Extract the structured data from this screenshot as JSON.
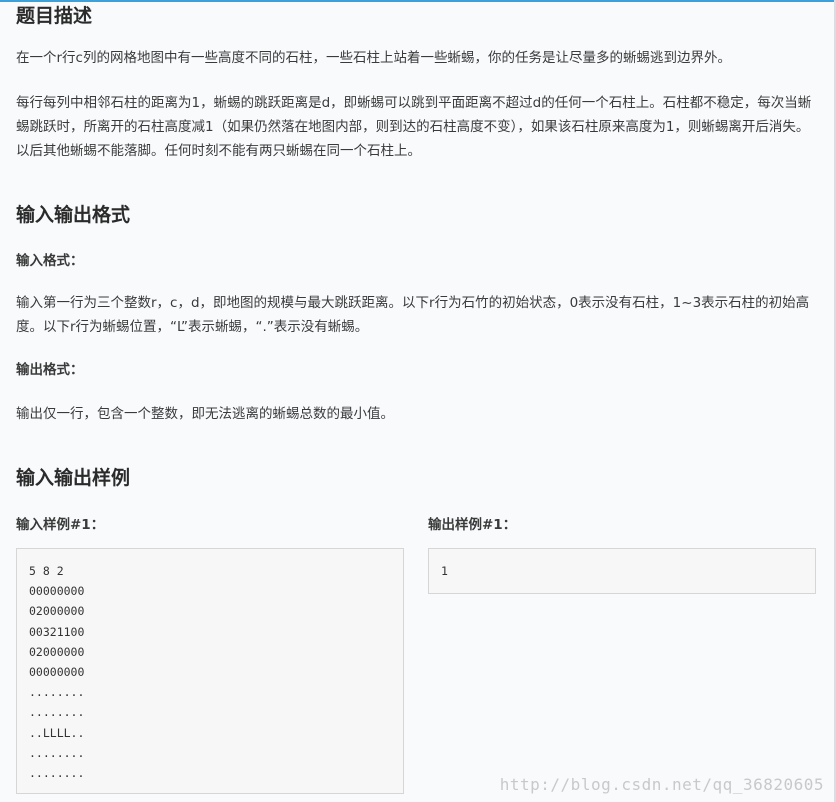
{
  "description": {
    "heading": "题目描述",
    "para1": "在一个r行c列的网格地图中有一些高度不同的石柱，一些石柱上站着一些蜥蜴，你的任务是让尽量多的蜥蜴逃到边界外。",
    "para2": "每行每列中相邻石柱的距离为1，蜥蜴的跳跃距离是d，即蜥蜴可以跳到平面距离不超过d的任何一个石柱上。石柱都不稳定，每次当蜥蜴跳跃时，所离开的石柱高度减1（如果仍然落在地图内部，则到达的石柱高度不变），如果该石柱原来高度为1，则蜥蜴离开后消失。以后其他蜥蜴不能落脚。任何时刻不能有两只蜥蜴在同一个石柱上。"
  },
  "io_format": {
    "heading": "输入输出格式",
    "input_label": "输入格式：",
    "input_text": "输入第一行为三个整数r，c，d，即地图的规模与最大跳跃距离。以下r行为石竹的初始状态，0表示没有石柱，1~3表示石柱的初始高度。以下r行为蜥蜴位置，“L”表示蜥蜴，“.”表示没有蜥蜴。",
    "output_label": "输出格式：",
    "output_text": "输出仅一行，包含一个整数，即无法逃离的蜥蜴总数的最小值。"
  },
  "samples": {
    "heading": "输入输出样例",
    "input_label": "输入样例#1：",
    "output_label": "输出样例#1：",
    "input_code": "5 8 2\n00000000\n02000000\n00321100\n02000000\n00000000\n........\n........\n..LLLL..\n........\n........",
    "output_code": "1"
  },
  "watermark": "http://blog.csdn.net/qq_36820605"
}
